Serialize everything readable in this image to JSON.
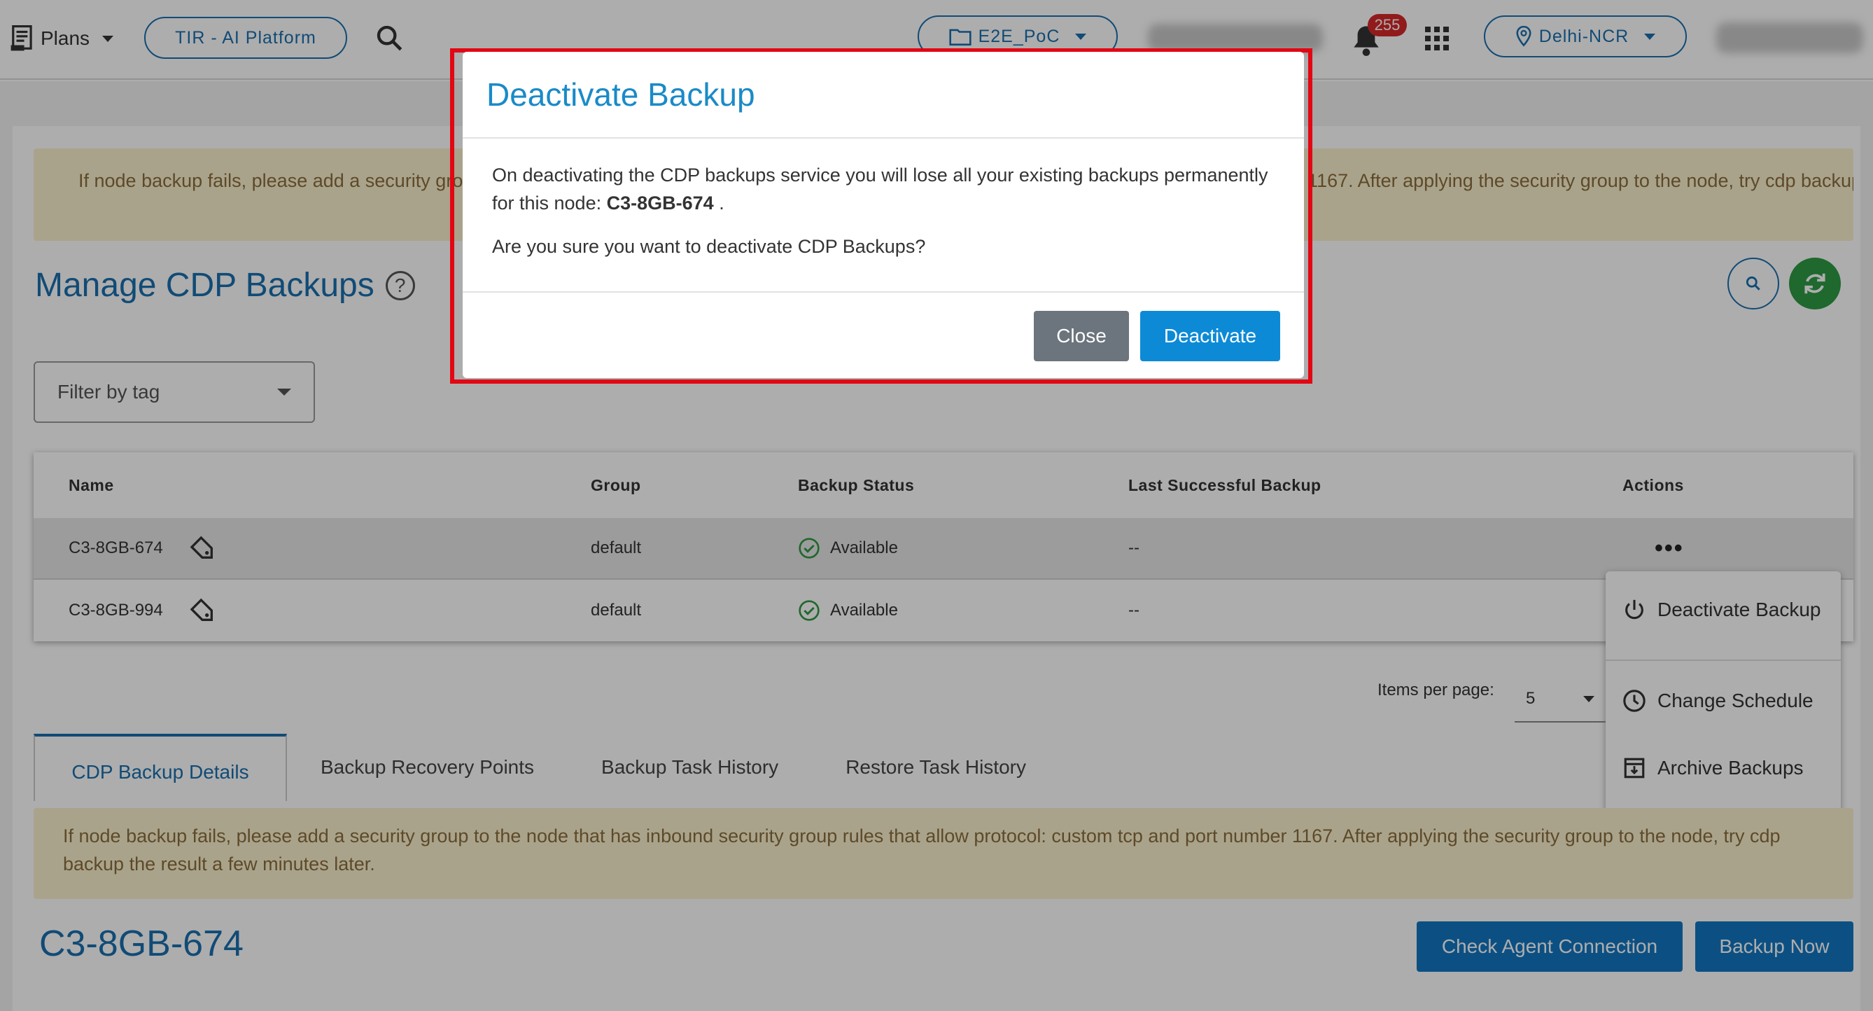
{
  "navbar": {
    "plans_label": "Plans",
    "platform_label": "TIR - AI Platform",
    "project_label": "E2E_PoC",
    "notification_count": "255",
    "region_label": "Delhi-NCR"
  },
  "alert_banner": "If node backup fails, please add a security group to the node that has inbound security group rules that allow protocol: custom tcp and port number 1167. After applying the security group to the node, try cdp backup the result a few minutes later.",
  "page": {
    "title": "Manage CDP Backups",
    "filter_placeholder": "Filter by tag"
  },
  "table": {
    "headers": {
      "name": "Name",
      "group": "Group",
      "status": "Backup Status",
      "last": "Last Successful Backup",
      "actions": "Actions"
    },
    "rows": [
      {
        "name": "C3-8GB-674",
        "group": "default",
        "status": "Available",
        "last": "--"
      },
      {
        "name": "C3-8GB-994",
        "group": "default",
        "status": "Available",
        "last": "--"
      }
    ]
  },
  "actions_menu": {
    "deactivate": "Deactivate Backup",
    "change_schedule": "Change Schedule",
    "archive": "Archive Backups"
  },
  "pagination": {
    "label": "Items per page:",
    "value": "5"
  },
  "tabs": {
    "details": "CDP Backup Details",
    "recovery": "Backup Recovery Points",
    "task_history": "Backup Task History",
    "restore_history": "Restore Task History"
  },
  "details": {
    "node_name": "C3-8GB-674",
    "check_agent_label": "Check Agent Connection",
    "backup_now_label": "Backup Now"
  },
  "modal": {
    "title": "Deactivate Backup",
    "body_text": "On deactivating the CDP backups service you will lose all your existing backups permanently for this node:",
    "node_name": "C3-8GB-674",
    "body_suffix": ".",
    "confirm_question": "Are you sure you want to deactivate CDP Backups?",
    "close_label": "Close",
    "deactivate_label": "Deactivate"
  },
  "colors": {
    "brand_blue": "#1a6fae",
    "modal_title": "#1a8ac8",
    "deactivate_button": "#0d8ad6",
    "close_button": "#6c757d",
    "highlight_border": "#e30613",
    "refresh_green": "#2e9a44",
    "warning_bg": "#fbf1cf"
  }
}
